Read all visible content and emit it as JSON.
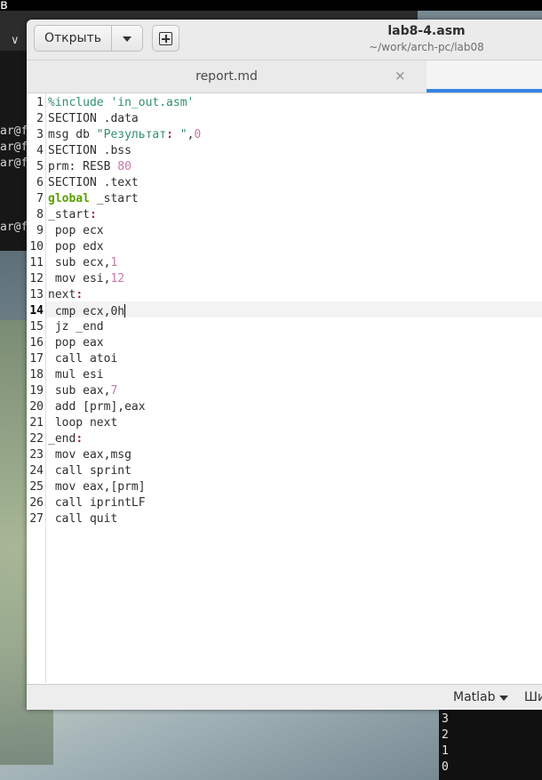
{
  "background": {
    "top_fragment": "в",
    "terminal_chevron": "∨",
    "terminal_prompts": [
      "ar@f",
      "ar@f",
      "ar@f",
      "ar@f"
    ],
    "terminal2_lines": [
      "3",
      "2",
      "1",
      "0"
    ]
  },
  "header": {
    "open_label": "Открыть",
    "title": "lab8-4.asm",
    "path": "~/work/arch-pc/lab08"
  },
  "tabs": [
    {
      "label": "report.md",
      "close": "×"
    }
  ],
  "editor": {
    "current_line": 14,
    "lines": [
      "1",
      "2",
      "3",
      "4",
      "5",
      "6",
      "7",
      "8",
      "9",
      "10",
      "11",
      "12",
      "13",
      "14",
      "15",
      "16",
      "17",
      "18",
      "19",
      "20",
      "21",
      "22",
      "23",
      "24",
      "25",
      "26",
      "27"
    ],
    "code": {
      "l1": "%include 'in_out.asm'",
      "l2": "SECTION .data",
      "l3a": "msg db ",
      "l3b": "\"Результат",
      "l3c": ": ",
      "l3d": "\"",
      "l3e": ",",
      "l3f": "0",
      "l4": "SECTION .bss",
      "l5a": "prm",
      "l5b": ": RESB ",
      "l5c": "80",
      "l6": "SECTION .text",
      "l7a": "global",
      "l7b": " _start",
      "l8a": "_start",
      "l8b": ":",
      "l9": " pop ecx",
      "l10": " pop edx",
      "l11a": " sub ecx,",
      "l11b": "1",
      "l12a": " mov esi,",
      "l12b": "12",
      "l13a": "next",
      "l13b": ":",
      "l14": " cmp ecx,0h",
      "l15": " jz _end",
      "l16": " pop eax",
      "l17": " call atoi",
      "l18": " mul esi",
      "l19a": " sub eax,",
      "l19b": "7",
      "l20": " add [prm],eax",
      "l21": " loop next",
      "l22a": "_end",
      "l22b": ":",
      "l23": " mov eax,msg",
      "l24": " call sprint",
      "l25": " mov eax,[prm]",
      "l26": " call iprintLF",
      "l27": " call quit"
    }
  },
  "status": {
    "language": "Matlab",
    "width_label": "Ши"
  }
}
